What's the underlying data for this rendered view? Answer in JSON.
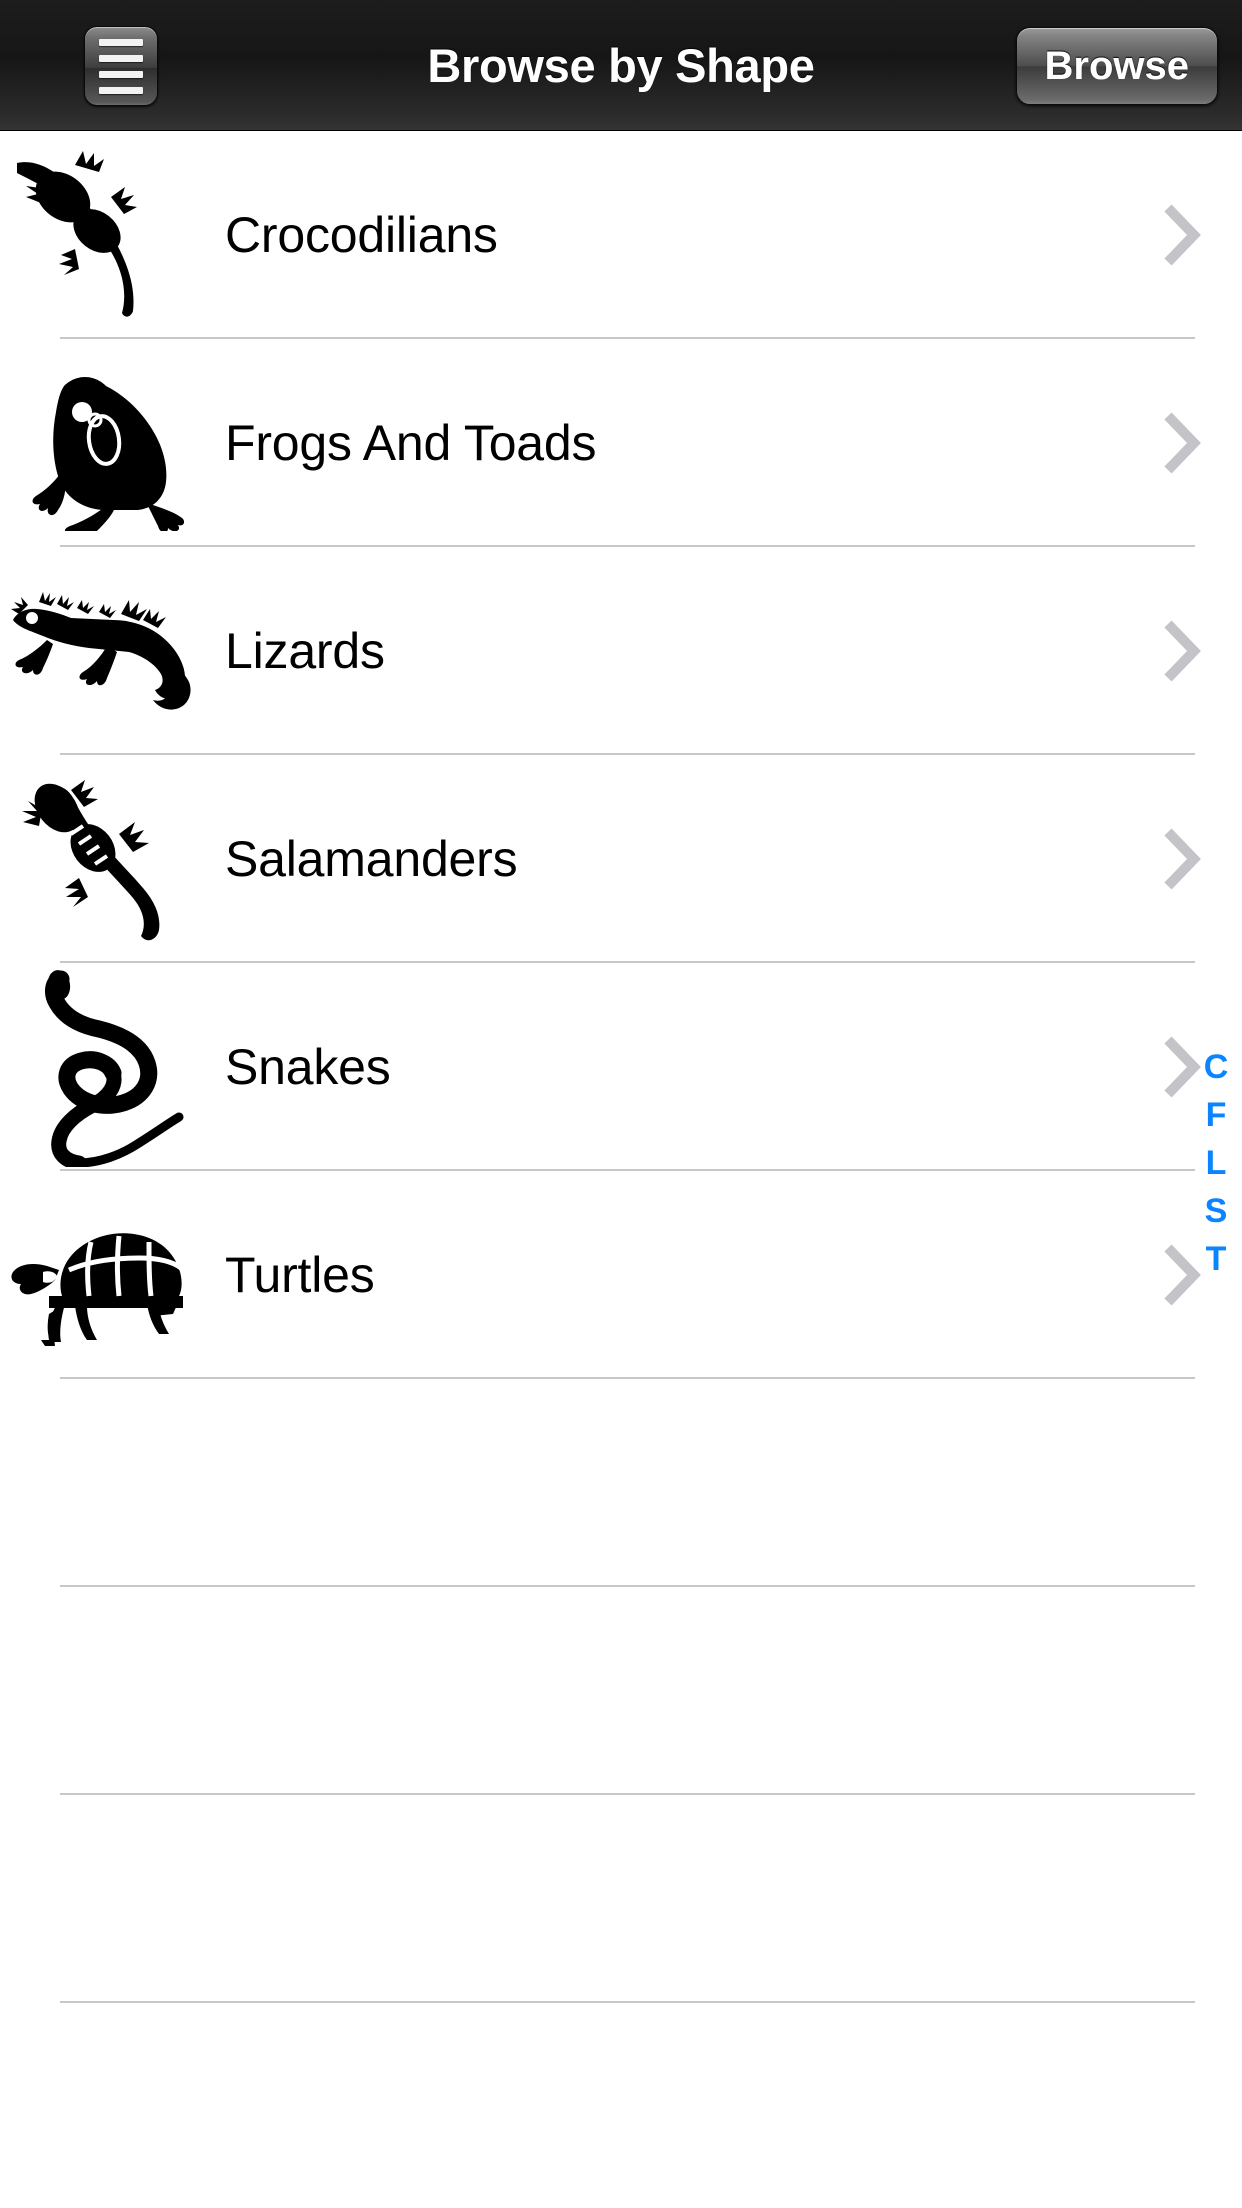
{
  "header": {
    "title": "Browse by Shape",
    "menu_icon": "hamburger-menu-icon",
    "browse_label": "Browse"
  },
  "list": {
    "rows": [
      {
        "label": "Crocodilians",
        "icon": "crocodile-silhouette-icon",
        "chevron": "chevron-right-icon"
      },
      {
        "label": "Frogs And Toads",
        "icon": "toad-silhouette-icon",
        "chevron": "chevron-right-icon"
      },
      {
        "label": "Lizards",
        "icon": "lizard-silhouette-icon",
        "chevron": "chevron-right-icon"
      },
      {
        "label": "Salamanders",
        "icon": "salamander-silhouette-icon",
        "chevron": "chevron-right-icon"
      },
      {
        "label": "Snakes",
        "icon": "snake-silhouette-icon",
        "chevron": "chevron-right-icon"
      },
      {
        "label": "Turtles",
        "icon": "turtle-silhouette-icon",
        "chevron": "chevron-right-icon"
      }
    ],
    "empty_row_count": 4
  },
  "index_bar": {
    "letters": [
      "C",
      "F",
      "L",
      "S",
      "T"
    ],
    "color": "#0a84ff"
  },
  "colors": {
    "navbar_top": "#1d1d1d",
    "navbar_bottom": "#343434",
    "separator": "#c8c8c8",
    "chevron": "#c3c3c8",
    "label_text": "#000000",
    "background": "#ffffff"
  }
}
